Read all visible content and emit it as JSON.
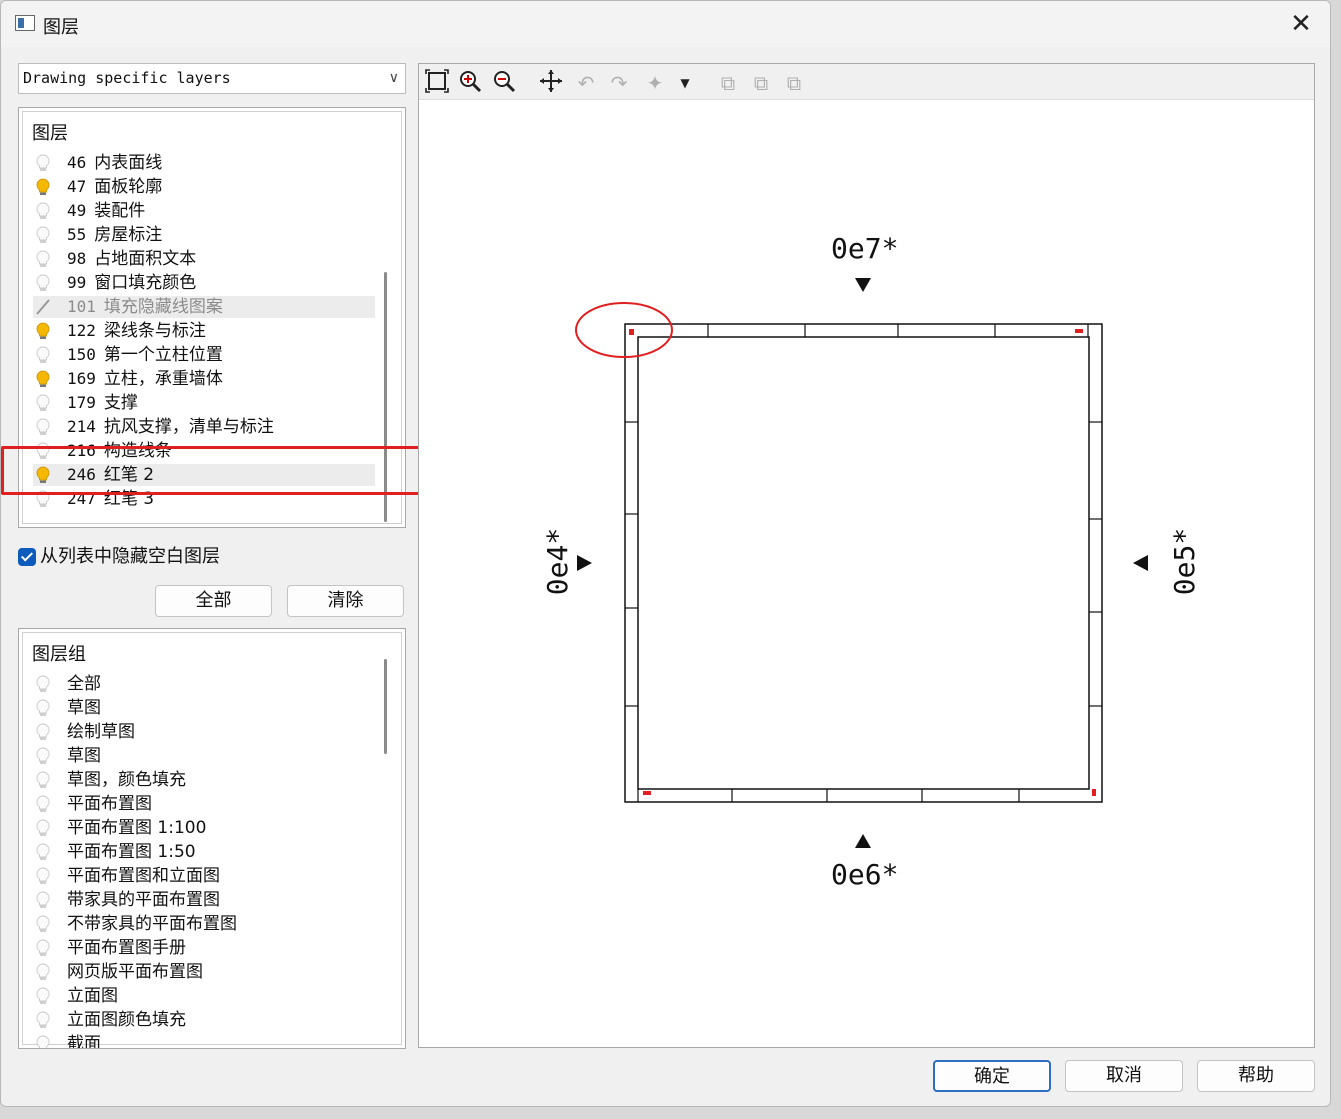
{
  "window": {
    "title": "图层",
    "close_label": "✕"
  },
  "dropdown": {
    "value": "Drawing specific layers"
  },
  "layers": {
    "header": "图层",
    "items": [
      {
        "num": "46",
        "name": "内表面线",
        "state": "off"
      },
      {
        "num": "47",
        "name": "面板轮廓",
        "state": "on"
      },
      {
        "num": "49",
        "name": "装配件",
        "state": "off"
      },
      {
        "num": "55",
        "name": "房屋标注",
        "state": "off"
      },
      {
        "num": "98",
        "name": "占地面积文本",
        "state": "off"
      },
      {
        "num": "99",
        "name": "窗口填充颜色",
        "state": "off"
      },
      {
        "num": "101",
        "name": "填充隐藏线图案",
        "state": "disabled"
      },
      {
        "num": "122",
        "name": "梁线条与标注",
        "state": "on"
      },
      {
        "num": "150",
        "name": "第一个立柱位置",
        "state": "off"
      },
      {
        "num": "169",
        "name": "立柱，承重墙体",
        "state": "on"
      },
      {
        "num": "179",
        "name": "支撑",
        "state": "off"
      },
      {
        "num": "214",
        "name": "抗风支撑，清单与标注",
        "state": "off"
      },
      {
        "num": "216",
        "name": "构造线条",
        "state": "off"
      },
      {
        "num": "246",
        "name": "红笔 2",
        "state": "on"
      },
      {
        "num": "247",
        "name": "红笔 3",
        "state": "off"
      }
    ]
  },
  "hide_empty": {
    "label": "从列表中隐藏空白图层",
    "checked": true
  },
  "buttons": {
    "all": "全部",
    "clear": "清除",
    "ok": "确定",
    "cancel": "取消",
    "help": "帮助"
  },
  "groups": {
    "header": "图层组",
    "items": [
      "全部",
      "草图",
      "绘制草图",
      "草图",
      "草图，颜色填充",
      "平面布置图",
      "平面布置图 1:100",
      "平面布置图 1:50",
      "平面布置图和立面图",
      "带家具的平面布置图",
      "不带家具的平面布置图",
      "平面布置图手册",
      "网页版平面布置图",
      "立面图",
      "立面图颜色填充",
      "截面"
    ]
  },
  "preview": {
    "labels": {
      "top": "0e7*",
      "bottom": "0e6*",
      "left": "0e4*",
      "right": "0e5*"
    },
    "toolbar_icons": [
      "zoom-extents-icon",
      "zoom-in-icon",
      "zoom-out-icon",
      "pan-icon",
      "undo-icon",
      "redo-icon",
      "snap-icon",
      "dropdown-arrow-icon",
      "copy-icon",
      "export-icon",
      "paste-icon"
    ],
    "annotation_color": "#e02020"
  }
}
